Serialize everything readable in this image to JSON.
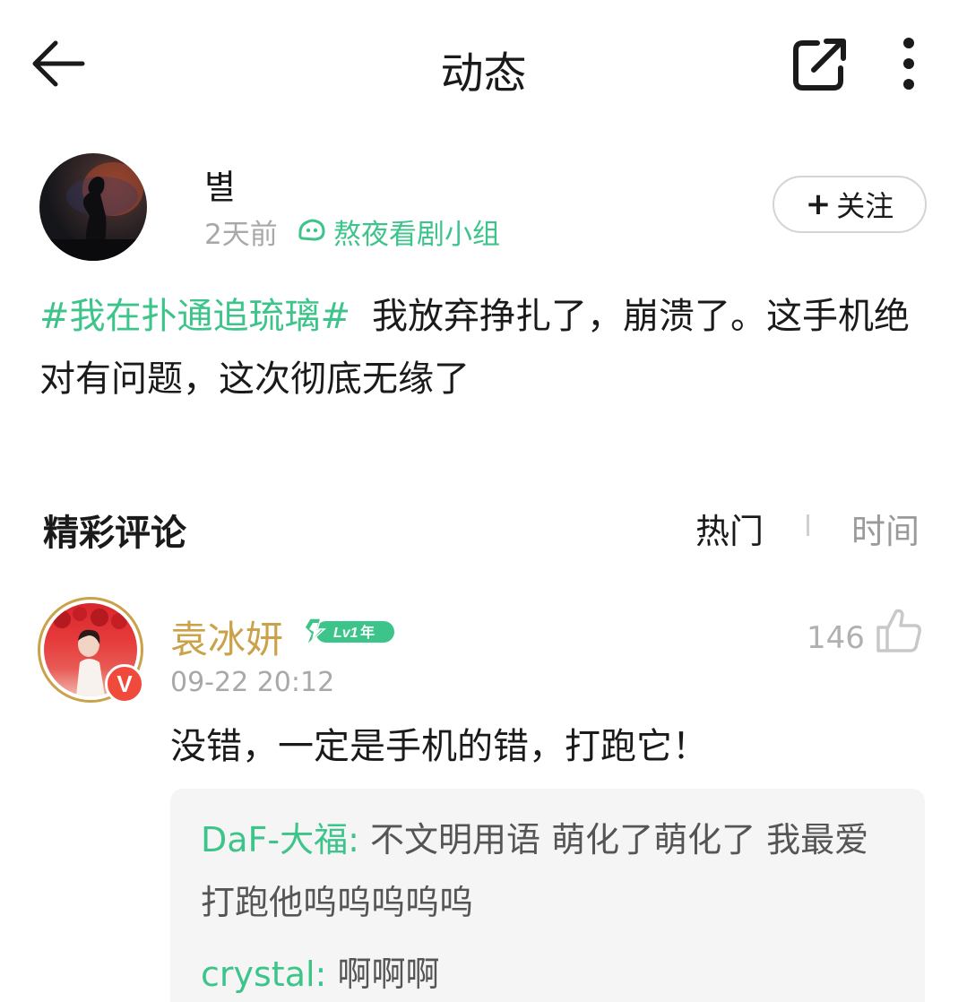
{
  "header": {
    "title": "动态"
  },
  "post": {
    "author": "별",
    "time": "2天前",
    "group": "熬夜看剧小组",
    "follow_label": "关注",
    "hashtag": "#我在扑通追琉璃#",
    "text": "我放弃挣扎了，崩溃了。这手机绝对有问题，这次彻底无缘了"
  },
  "comments": {
    "title": "精彩评论",
    "sort": {
      "hot": "热门",
      "time": "时间"
    },
    "items": [
      {
        "author": "袁冰妍",
        "level": "Lv1",
        "level_suffix": "年",
        "time": "09-22 20:12",
        "likes": "146",
        "text": "没错，一定是手机的错，打跑它！",
        "verified_badge": "V",
        "replies": [
          {
            "author": "DaF-大福:",
            "text": "不文明用语 萌化了萌化了 我最爱打跑他呜呜呜呜呜"
          },
          {
            "author": "crystal:",
            "text": "啊啊啊"
          }
        ]
      }
    ]
  },
  "colors": {
    "accent_green": "#3cc48a",
    "vip_gold": "#c9a24a",
    "verified_red": "#f04a3c"
  },
  "icons": [
    "back-arrow-icon",
    "share-icon",
    "more-vertical-icon",
    "group-icon",
    "lightning-icon",
    "thumbs-up-icon"
  ]
}
